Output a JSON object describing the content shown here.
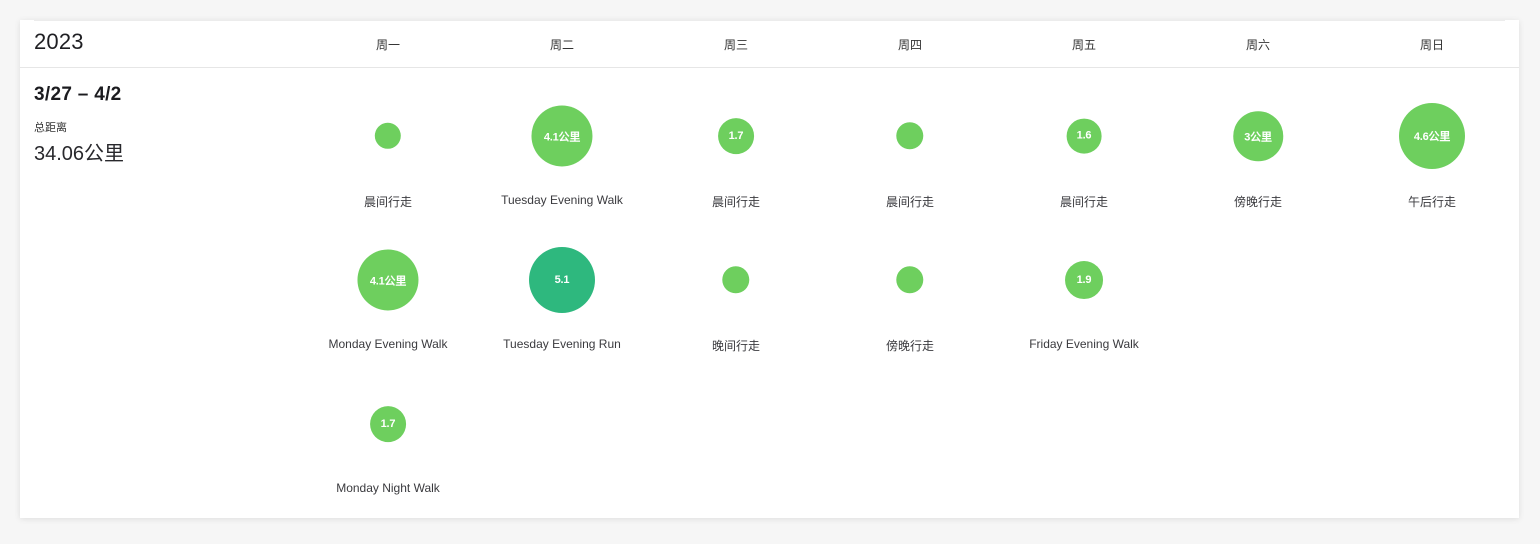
{
  "calendar": {
    "year": "2023",
    "weekdays": [
      "周一",
      "周二",
      "周三",
      "周四",
      "周五",
      "周六",
      "周日"
    ]
  },
  "summary": {
    "week_range": "3/27 – 4/2",
    "total_distance_label": "总距离",
    "total_distance_value": "34.06公里"
  },
  "colors": {
    "walk": "#6ecf5e",
    "run": "#2eb87e"
  },
  "activities": [
    {
      "day": 0,
      "row": 0,
      "name": "晨间行走",
      "label": "",
      "type": "walk",
      "distance_km": 0.8
    },
    {
      "day": 1,
      "row": 0,
      "name": "Tuesday Evening Walk",
      "label": "4.1公里",
      "type": "walk",
      "distance_km": 4.1
    },
    {
      "day": 2,
      "row": 0,
      "name": "晨间行走",
      "label": "1.7",
      "type": "walk",
      "distance_km": 1.7
    },
    {
      "day": 3,
      "row": 0,
      "name": "晨间行走",
      "label": "",
      "type": "walk",
      "distance_km": 0.9
    },
    {
      "day": 4,
      "row": 0,
      "name": "晨间行走",
      "label": "1.6",
      "type": "walk",
      "distance_km": 1.6
    },
    {
      "day": 5,
      "row": 0,
      "name": "傍晚行走",
      "label": "3公里",
      "type": "walk",
      "distance_km": 3.0
    },
    {
      "day": 6,
      "row": 0,
      "name": "午后行走",
      "label": "4.6公里",
      "type": "walk",
      "distance_km": 4.6
    },
    {
      "day": 0,
      "row": 1,
      "name": "Monday Evening Walk",
      "label": "4.1公里",
      "type": "walk",
      "distance_km": 4.1
    },
    {
      "day": 1,
      "row": 1,
      "name": "Tuesday Evening Run",
      "label": "5.1",
      "type": "run",
      "distance_km": 5.1
    },
    {
      "day": 2,
      "row": 1,
      "name": "晚间行走",
      "label": "",
      "type": "walk",
      "distance_km": 0.9
    },
    {
      "day": 3,
      "row": 1,
      "name": "傍晚行走",
      "label": "",
      "type": "walk",
      "distance_km": 0.9
    },
    {
      "day": 4,
      "row": 1,
      "name": "Friday Evening Walk",
      "label": "1.9",
      "type": "walk",
      "distance_km": 1.9
    },
    {
      "day": 0,
      "row": 2,
      "name": "Monday Night Walk",
      "label": "1.7",
      "type": "walk",
      "distance_km": 1.7
    }
  ]
}
